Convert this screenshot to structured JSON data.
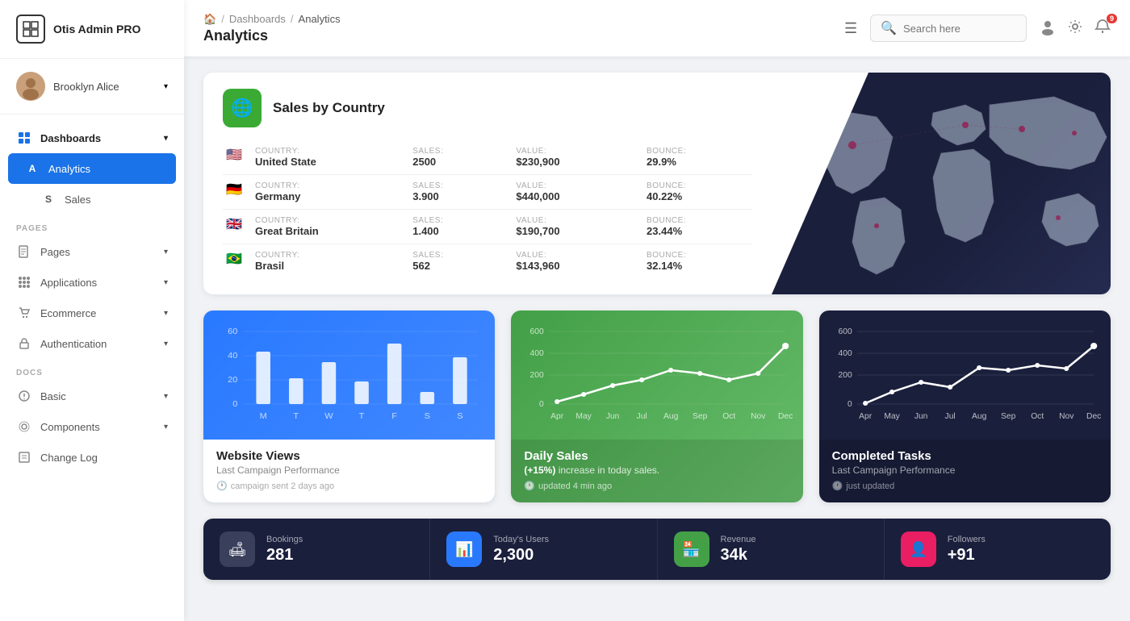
{
  "app": {
    "name": "Otis Admin PRO"
  },
  "sidebar": {
    "user": {
      "name": "Brooklyn Alice"
    },
    "nav": {
      "section_pages": "PAGES",
      "section_docs": "DOCS"
    },
    "items": [
      {
        "id": "dashboards",
        "label": "Dashboards",
        "icon": "⊞",
        "hasChildren": true,
        "active": false
      },
      {
        "id": "analytics",
        "label": "Analytics",
        "letter": "A",
        "active": true
      },
      {
        "id": "sales",
        "label": "Sales",
        "letter": "S",
        "active": false
      },
      {
        "id": "pages",
        "label": "Pages",
        "icon": "🖼",
        "hasChildren": true
      },
      {
        "id": "applications",
        "label": "Applications",
        "icon": "⋮⋮",
        "hasChildren": true
      },
      {
        "id": "ecommerce",
        "label": "Ecommerce",
        "icon": "🛍",
        "hasChildren": true
      },
      {
        "id": "authentication",
        "label": "Authentication",
        "icon": "📋",
        "hasChildren": true
      },
      {
        "id": "basic",
        "label": "Basic",
        "icon": "✏",
        "hasChildren": true
      },
      {
        "id": "components",
        "label": "Components",
        "icon": "⚙",
        "hasChildren": true
      },
      {
        "id": "changelog",
        "label": "Change Log",
        "icon": "📝"
      }
    ]
  },
  "header": {
    "breadcrumb": {
      "home_icon": "🏠",
      "dashboards": "Dashboards",
      "current": "Analytics"
    },
    "title": "Analytics",
    "search_placeholder": "Search here",
    "notification_count": "9"
  },
  "sales_by_country": {
    "title": "Sales by Country",
    "columns": {
      "country": "Country:",
      "sales": "Sales:",
      "value": "Value:",
      "bounce": "Bounce:"
    },
    "rows": [
      {
        "flag": "🇺🇸",
        "country": "United State",
        "sales": "2500",
        "value": "$230,900",
        "bounce": "29.9%"
      },
      {
        "flag": "🇩🇪",
        "country": "Germany",
        "sales": "3.900",
        "value": "$440,000",
        "bounce": "40.22%"
      },
      {
        "flag": "🇬🇧",
        "country": "Great Britain",
        "sales": "1.400",
        "value": "$190,700",
        "bounce": "23.44%"
      },
      {
        "flag": "🇧🇷",
        "country": "Brasil",
        "sales": "562",
        "value": "$143,960",
        "bounce": "32.14%"
      }
    ]
  },
  "charts": {
    "website_views": {
      "title": "Website Views",
      "subtitle": "Last Campaign Performance",
      "footer": "campaign sent 2 days ago",
      "y_labels": [
        "60",
        "40",
        "20",
        "0"
      ],
      "x_labels": [
        "M",
        "T",
        "W",
        "T",
        "F",
        "S",
        "S"
      ],
      "bars": [
        45,
        22,
        38,
        18,
        55,
        10,
        42
      ]
    },
    "daily_sales": {
      "title": "Daily Sales",
      "subtitle_prefix": "(+15%)",
      "subtitle_suffix": "increase in today sales.",
      "footer": "updated 4 min ago",
      "y_labels": [
        "600",
        "400",
        "200",
        "0"
      ],
      "x_labels": [
        "Apr",
        "May",
        "Jun",
        "Jul",
        "Aug",
        "Sep",
        "Oct",
        "Nov",
        "Dec"
      ],
      "points": [
        20,
        80,
        150,
        200,
        280,
        250,
        200,
        250,
        480
      ]
    },
    "completed_tasks": {
      "title": "Completed Tasks",
      "subtitle": "Last Campaign Performance",
      "footer": "just updated",
      "y_labels": [
        "600",
        "400",
        "200",
        "0"
      ],
      "x_labels": [
        "Apr",
        "May",
        "Jun",
        "Jul",
        "Aug",
        "Sep",
        "Oct",
        "Nov",
        "Dec"
      ],
      "points": [
        10,
        100,
        180,
        140,
        300,
        280,
        320,
        290,
        480
      ]
    }
  },
  "stats": [
    {
      "id": "bookings",
      "icon": "🛋",
      "icon_class": "gray",
      "label": "Bookings",
      "value": "281"
    },
    {
      "id": "today_users",
      "icon": "📊",
      "icon_class": "blue",
      "label": "Today's Users",
      "value": "2,300"
    },
    {
      "id": "revenue",
      "icon": "🏪",
      "icon_class": "green",
      "label": "Revenue",
      "value": "34k"
    },
    {
      "id": "followers",
      "icon": "👤",
      "icon_class": "pink",
      "label": "Followers",
      "value": "+91"
    }
  ]
}
